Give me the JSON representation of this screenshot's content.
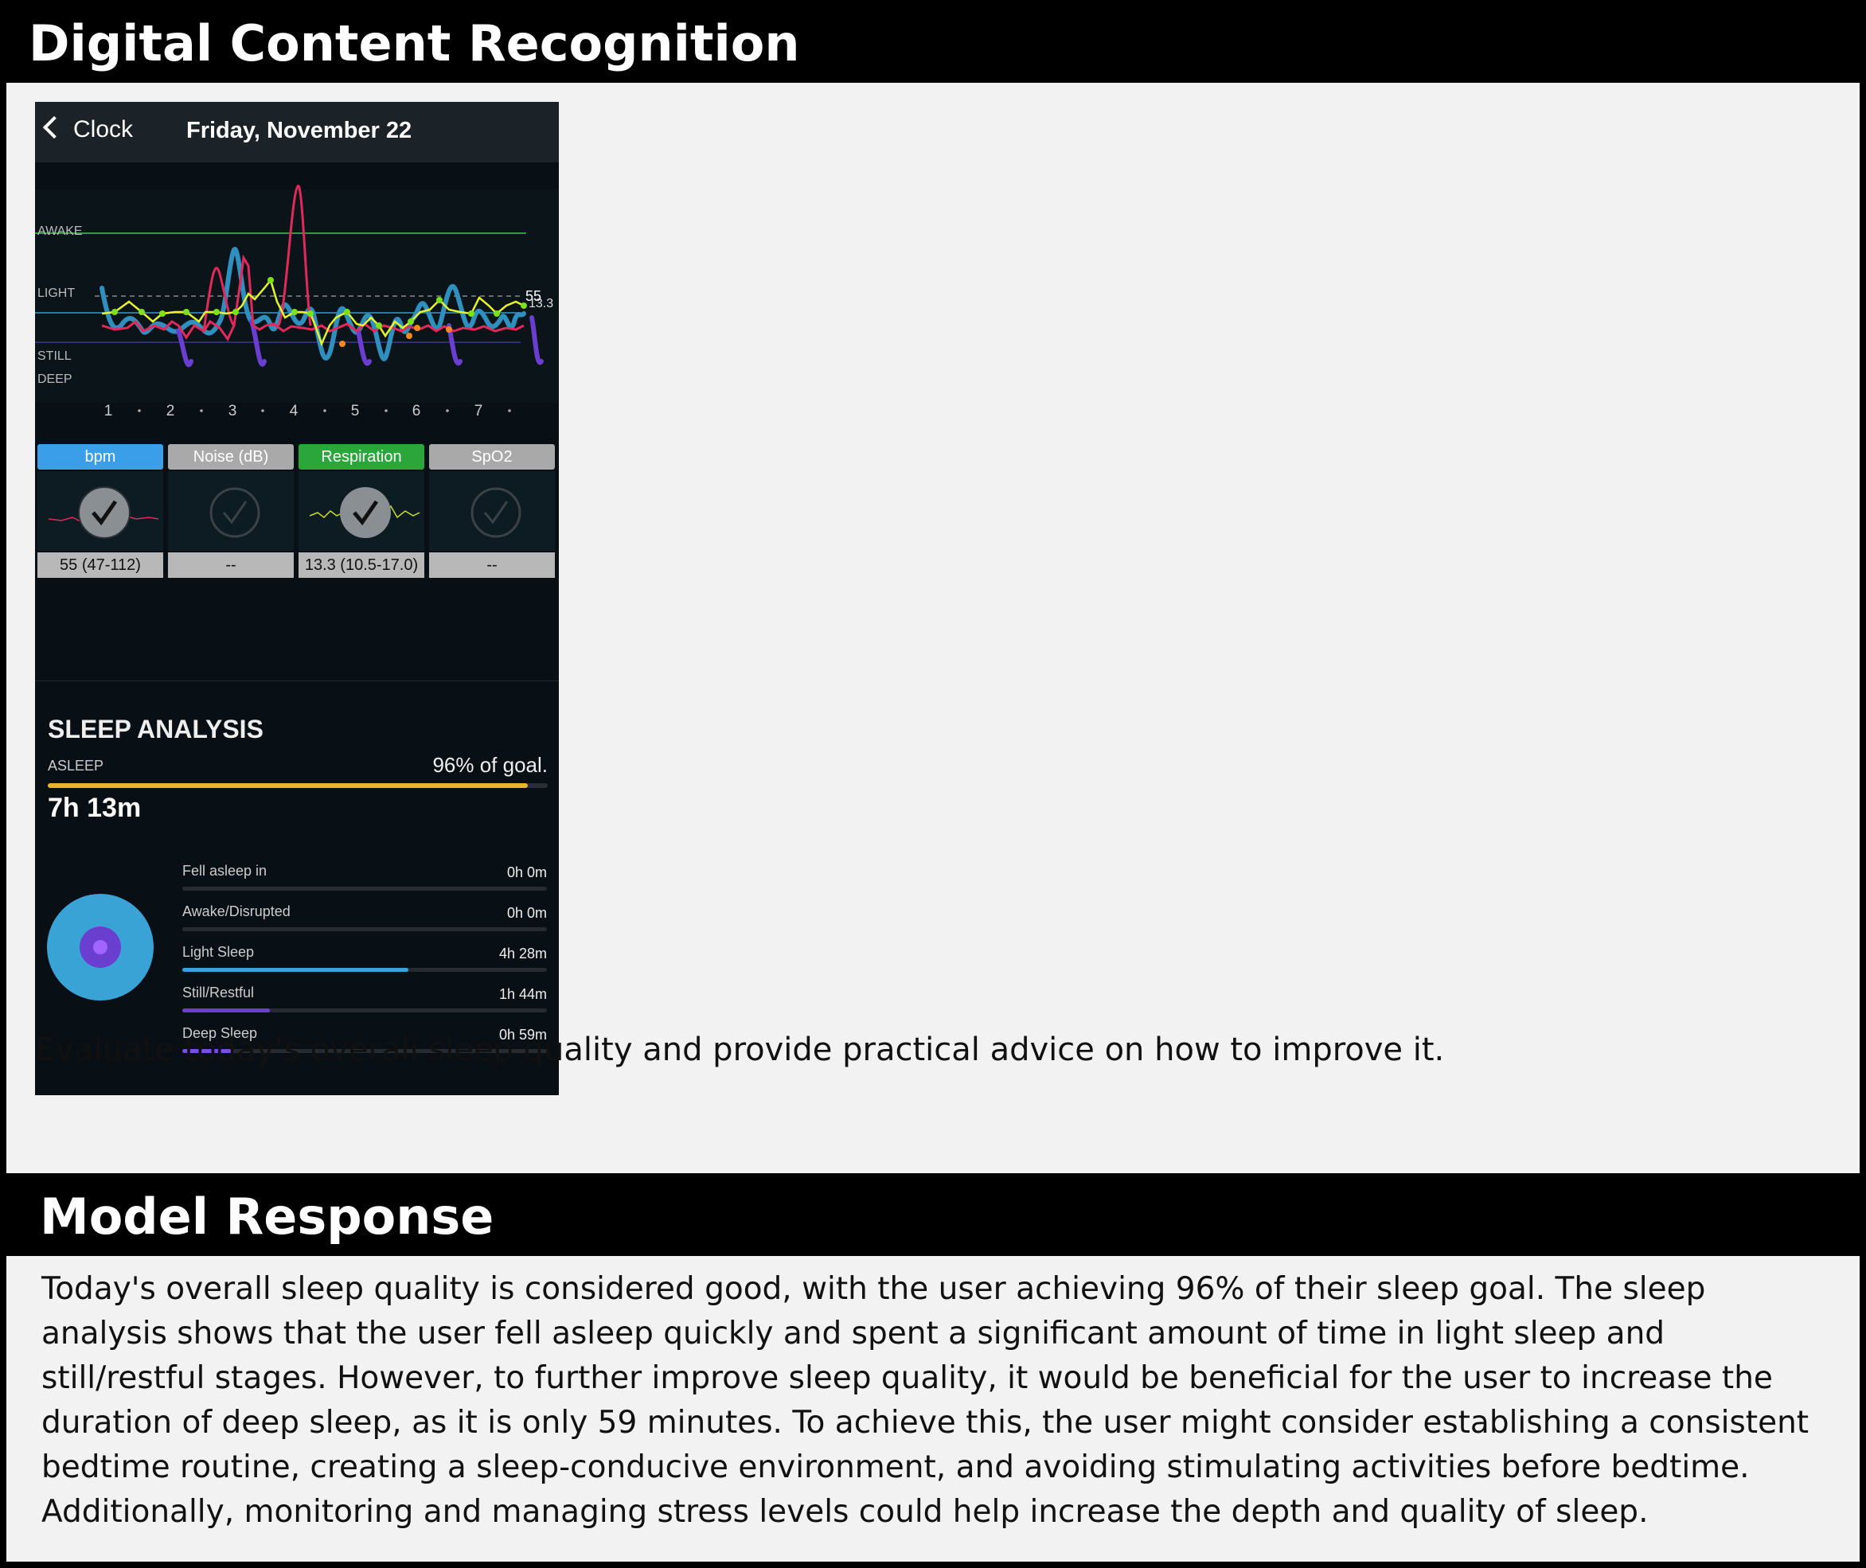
{
  "sections": {
    "top_title": "Digital Content Recognition",
    "bottom_title": "Model Response"
  },
  "prompt": "Evaluate today's overall sleep quality and provide practical advice on how to improve it.",
  "response": "Today's overall sleep quality is considered good, with the user achieving 96% of their sleep goal. The sleep analysis shows that the user fell asleep quickly and spent a significant amount of time in light sleep and still/restful stages. However, to further improve sleep quality, it would be beneficial for the user to increase the duration of deep sleep, as it is only 59 minutes. To achieve this, the user might consider establishing a consistent bedtime routine, creating a sleep-conducive environment, and avoiding stimulating activities before bedtime. Additionally, monitoring and managing stress levels could help increase the depth and quality of sleep.",
  "phone": {
    "back_label": "Clock",
    "back_icon": "chevron-left-icon",
    "date": "Friday, November 22",
    "chart": {
      "stage_labels": [
        "AWAKE",
        "LIGHT",
        "STILL",
        "DEEP"
      ],
      "hour_ticks": [
        "1",
        "2",
        "3",
        "4",
        "5",
        "6",
        "7"
      ],
      "end_value": "55",
      "end_value_2": "13.3",
      "colors": {
        "sleep_stage": "#2f8fbf",
        "deep": "#6a3fd0",
        "heart_rate": "#e02a5c",
        "respiration": "#e7f22a",
        "awake_line": "#2e9a3e",
        "still_line": "#2a7a9a"
      }
    },
    "sensors": [
      {
        "label": "bpm",
        "value": "55 (47-112)",
        "color": "#3a9ee8",
        "active": true
      },
      {
        "label": "Noise (dB)",
        "value": "--",
        "color": "#a9a9a9",
        "active": false
      },
      {
        "label": "Respiration",
        "value": "13.3 (10.5-17.0)",
        "color": "#2aa63a",
        "active": true
      },
      {
        "label": "SpO2",
        "value": "--",
        "color": "#a9a9a9",
        "active": false
      }
    ],
    "sleep_analysis": {
      "title": "SLEEP ANALYSIS",
      "asleep_label": "ASLEEP",
      "goal_text": "96% of goal.",
      "goal_fraction": 0.96,
      "total": "7h 13m",
      "colors": {
        "goal_bar": "#e6b52a",
        "outer_circle": "#3aa3d6",
        "inner_circle": "#6a3fd0"
      },
      "stats": [
        {
          "label": "Fell asleep in",
          "value": "0h 0m",
          "fraction": 0,
          "color": "#3aa3d6"
        },
        {
          "label": "Awake/Disrupted",
          "value": "0h 0m",
          "fraction": 0,
          "color": "#3aa3d6"
        },
        {
          "label": "Light Sleep",
          "value": "4h 28m",
          "fraction": 0.62,
          "color": "#3aa3d6"
        },
        {
          "label": "Still/Restful",
          "value": "1h 44m",
          "fraction": 0.24,
          "color": "#6a3fd0"
        },
        {
          "label": "Deep Sleep",
          "value": "0h 59m",
          "fraction": 0.14,
          "color": "#7a4fe0"
        }
      ]
    }
  }
}
